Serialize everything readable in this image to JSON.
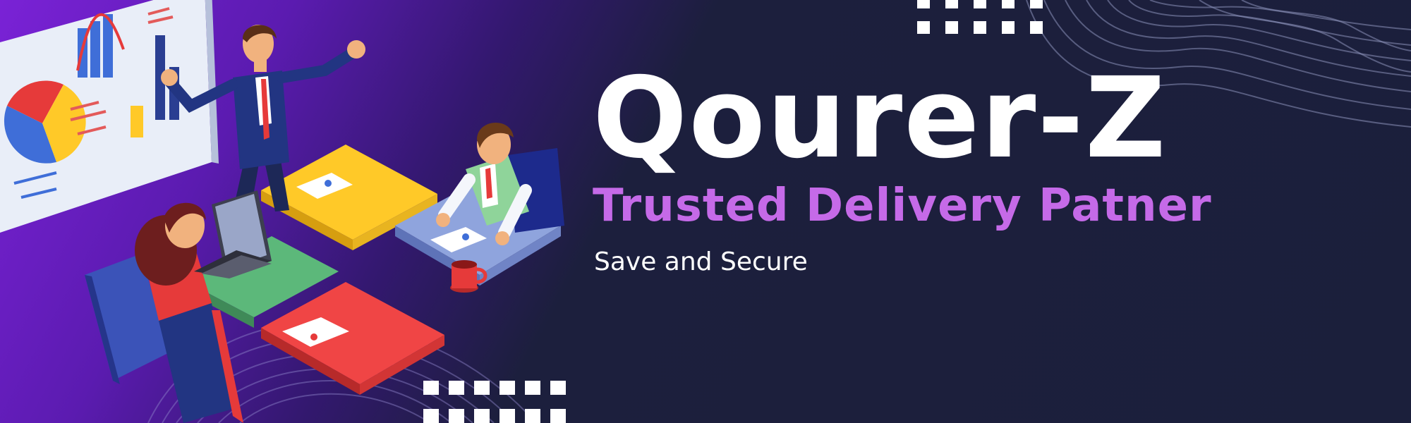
{
  "banner": {
    "title": "Qourer-Z",
    "subtitle": "Trusted Delivery Patner",
    "tagline": "Save and Secure"
  },
  "colors": {
    "background": "#1b1f3b",
    "gradient_start": "#7a22d6",
    "title": "#ffffff",
    "subtitle": "#c56ae8",
    "tagline": "#ffffff",
    "puzzle_yellow": "#ffc928",
    "puzzle_blue": "#8fa4dd",
    "puzzle_green": "#5cb87a",
    "puzzle_red": "#f04545"
  },
  "illustration": {
    "icons": [
      "presentation-board-icon",
      "businessman-icon",
      "seated-man-icon",
      "seated-woman-icon",
      "laptop-icon",
      "puzzle-table-icon",
      "coffee-mug-icon",
      "dot-grid-pattern",
      "wave-lines-pattern"
    ]
  }
}
